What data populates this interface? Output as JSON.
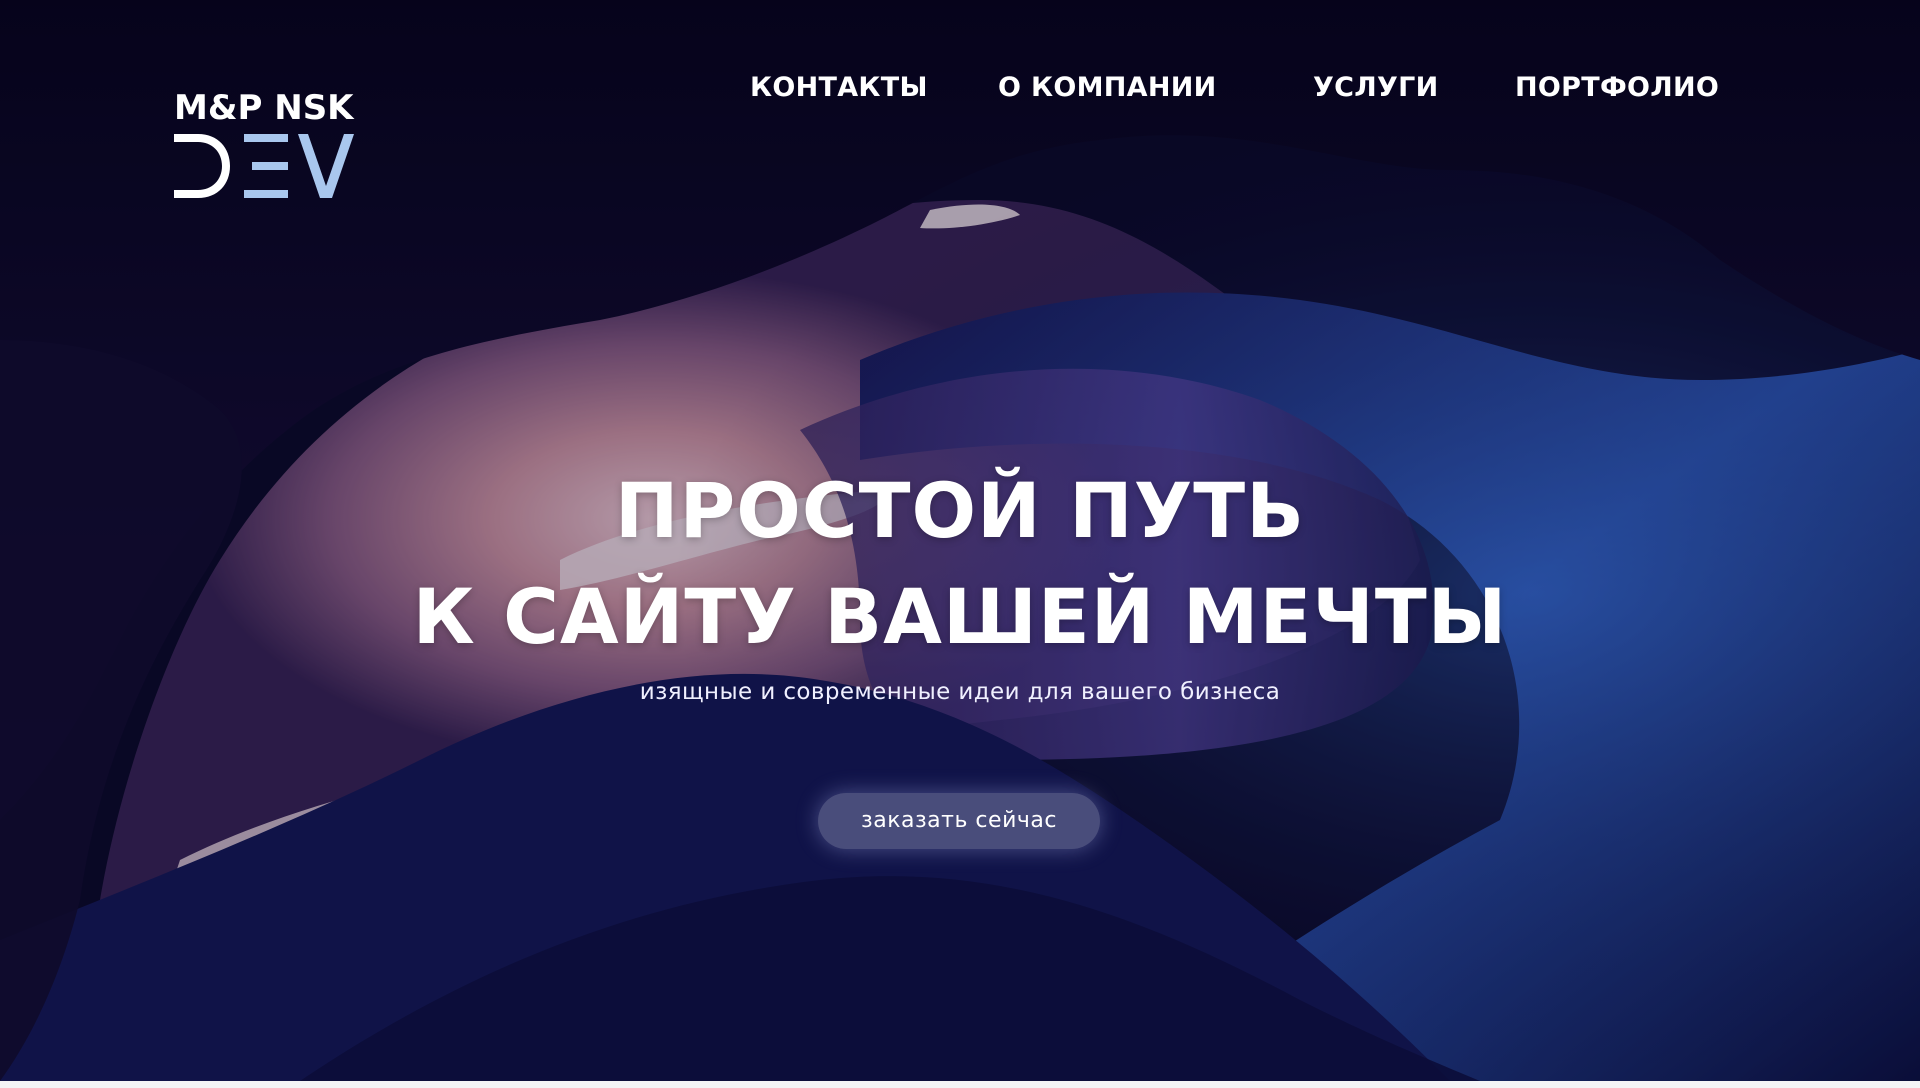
{
  "logo": {
    "line1": "M&P NSK",
    "line2": "DEV"
  },
  "nav": {
    "items": [
      {
        "label": "КОНТАКТЫ"
      },
      {
        "label": "О КОМПАНИИ"
      },
      {
        "label": "УСЛУГИ"
      },
      {
        "label": "ПОРТФОЛИО"
      }
    ]
  },
  "hero": {
    "headline_line1": "ПРОСТОЙ ПУТЬ",
    "headline_line2": "К САЙТУ ВАШЕЙ МЕЧТЫ",
    "subtitle": "изящные и современные идеи для вашего бизнеса",
    "cta_label": "заказать сейчас",
    "background_image": "slot-canyon-photo"
  },
  "colors": {
    "text": "#ffffff",
    "logo_accent": "#a9c7ee",
    "background_dark": "#0a0820",
    "cta_fill": "#787da5"
  }
}
